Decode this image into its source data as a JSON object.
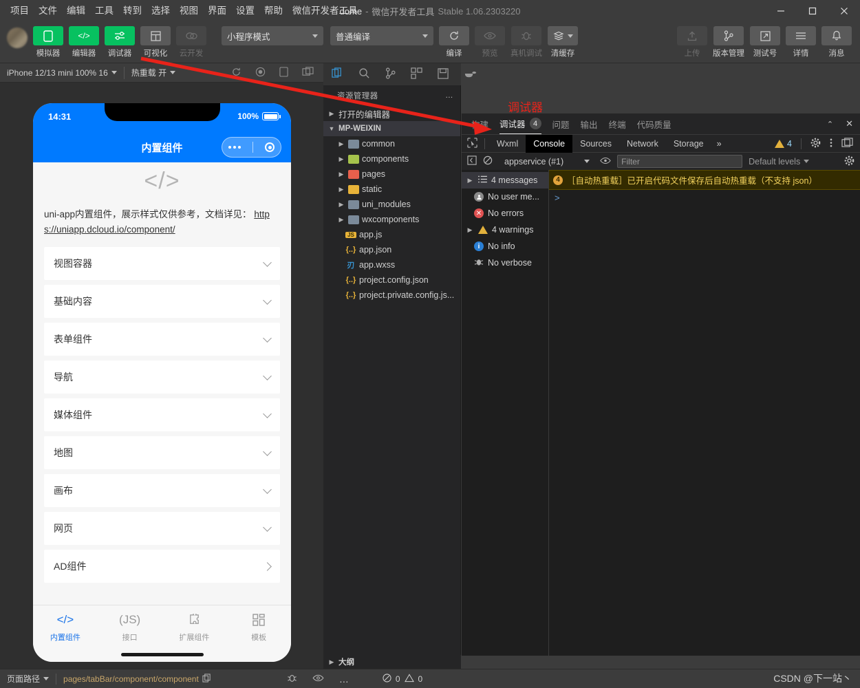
{
  "titlebar": {
    "menus": [
      "项目",
      "文件",
      "编辑",
      "工具",
      "转到",
      "选择",
      "视图",
      "界面",
      "设置",
      "帮助",
      "微信开发者工具"
    ],
    "project_name": "dome",
    "separator": "-",
    "app_name": "微信开发者工具",
    "version": "Stable 1.06.2303220",
    "window_controls": {
      "minimize": "—",
      "maximize": "▢",
      "close": "✕"
    }
  },
  "toolbar": {
    "left_items": [
      {
        "label": "模拟器",
        "icon": "phone-icon",
        "glyph": "▯",
        "state": "active"
      },
      {
        "label": "编辑器",
        "icon": "code-icon",
        "glyph": "</>",
        "state": "active"
      },
      {
        "label": "调试器",
        "icon": "sliders-icon",
        "glyph": "⇌",
        "state": "active"
      },
      {
        "label": "可视化",
        "icon": "layout-icon",
        "glyph": "▤",
        "state": "inactive"
      },
      {
        "label": "云开发",
        "icon": "cloud-icon",
        "glyph": "☁",
        "state": "disabled"
      }
    ],
    "mode_select": "小程序模式",
    "compile_select": "普通编译",
    "center_items": [
      {
        "label": "编译",
        "icon": "refresh-icon",
        "glyph": "⟳",
        "state": "active"
      },
      {
        "label": "预览",
        "icon": "eye-icon",
        "glyph": "👁",
        "state": "disabled"
      },
      {
        "label": "真机调试",
        "icon": "bug-icon",
        "glyph": "🐞",
        "state": "disabled"
      },
      {
        "label": "清缓存",
        "icon": "layers-icon",
        "glyph": "≋",
        "state": "active"
      }
    ],
    "right_items": [
      {
        "label": "上传",
        "icon": "upload-icon",
        "glyph": "↥",
        "state": "disabled"
      },
      {
        "label": "版本管理",
        "icon": "branch-icon",
        "glyph": "⑂",
        "state": "active"
      },
      {
        "label": "测试号",
        "icon": "external-link-icon",
        "glyph": "↗",
        "state": "active"
      },
      {
        "label": "详情",
        "icon": "menu-icon",
        "glyph": "≡",
        "state": "active"
      },
      {
        "label": "消息",
        "icon": "bell-icon",
        "glyph": "🔔",
        "state": "active"
      }
    ]
  },
  "simulator_bar": {
    "device": "iPhone 12/13 mini 100% 16",
    "hot_reload": "热重载 开",
    "icons": [
      "refresh-icon",
      "record-icon",
      "rotate-icon",
      "multi-window-icon"
    ]
  },
  "phone": {
    "status": {
      "time": "14:31",
      "battery_percent": "100%"
    },
    "nav_title": "内置组件",
    "capsule": {
      "dots": "•••",
      "circle": "◉"
    },
    "logo": "</>",
    "intro_text": "uni-app内置组件，展示样式仅供参考，文档详见：",
    "intro_link": "https://uniapp.dcloud.io/component/",
    "accordion": [
      {
        "label": "视图容器",
        "chevron": "down"
      },
      {
        "label": "基础内容",
        "chevron": "down"
      },
      {
        "label": "表单组件",
        "chevron": "down"
      },
      {
        "label": "导航",
        "chevron": "down"
      },
      {
        "label": "媒体组件",
        "chevron": "down"
      },
      {
        "label": "地图",
        "chevron": "down"
      },
      {
        "label": "画布",
        "chevron": "down"
      },
      {
        "label": "网页",
        "chevron": "down"
      },
      {
        "label": "AD组件",
        "chevron": "right"
      }
    ],
    "tabbar": [
      {
        "label": "内置组件",
        "icon": "code-icon",
        "glyph": "</>",
        "active": true
      },
      {
        "label": "接口",
        "icon": "js-icon",
        "glyph": "(JS)",
        "active": false
      },
      {
        "label": "扩展组件",
        "icon": "puzzle-icon",
        "glyph": "✧",
        "active": false
      },
      {
        "label": "模板",
        "icon": "grid-icon",
        "glyph": "▤",
        "active": false
      }
    ]
  },
  "explorer": {
    "activity_icons": [
      "files-icon",
      "search-icon",
      "source-control-icon",
      "extensions-icon",
      "save-icon",
      "docker-icon"
    ],
    "title": "资源管理器",
    "more": "…",
    "sections": [
      {
        "label": "打开的编辑器",
        "expanded": false
      },
      {
        "label": "MP-WEIXIN",
        "expanded": true,
        "selected": true
      }
    ],
    "tree": [
      {
        "name": "common",
        "type": "folder",
        "color": "blue"
      },
      {
        "name": "components",
        "type": "folder",
        "color": "green"
      },
      {
        "name": "pages",
        "type": "folder",
        "color": "red"
      },
      {
        "name": "static",
        "type": "folder",
        "color": "yellow"
      },
      {
        "name": "uni_modules",
        "type": "folder",
        "color": "blue"
      },
      {
        "name": "wxcomponents",
        "type": "folder",
        "color": "blue"
      },
      {
        "name": "app.js",
        "type": "file",
        "badge": "JS",
        "color": "#e8b339"
      },
      {
        "name": "app.json",
        "type": "file",
        "badge": "{..}",
        "color": "#e8b339"
      },
      {
        "name": "app.wxss",
        "type": "file",
        "badge": "刃",
        "color": "#3794d2"
      },
      {
        "name": "project.config.json",
        "type": "file",
        "badge": "{..}",
        "color": "#e8b339"
      },
      {
        "name": "project.private.config.js...",
        "type": "file",
        "badge": "{..}",
        "color": "#e8b339"
      }
    ],
    "outline": "大纲"
  },
  "debugger": {
    "annotation_label": "调试器",
    "panel_tabs": [
      {
        "label": "构建",
        "active": false
      },
      {
        "label": "调试器",
        "active": true,
        "badge": "4"
      },
      {
        "label": "问题",
        "active": false
      },
      {
        "label": "输出",
        "active": false
      },
      {
        "label": "终端",
        "active": false
      },
      {
        "label": "代码质量",
        "active": false
      }
    ],
    "panel_controls": {
      "collapse": "⌃",
      "close": "✕"
    },
    "devtool_tabs": [
      {
        "label": "Wxml",
        "active": false
      },
      {
        "label": "Console",
        "active": true
      },
      {
        "label": "Sources",
        "active": false
      },
      {
        "label": "Network",
        "active": false
      },
      {
        "label": "Storage",
        "active": false
      }
    ],
    "devtool_more": "»",
    "inspect_icon": "cursor-select-icon",
    "warning_count": "4",
    "devtool_right_icons": [
      "gear-icon",
      "kebab-menu-icon",
      "dock-icon"
    ],
    "console_toolbar": {
      "sidebar_toggle_icon": "sidebar-toggle-icon",
      "clear_icon": "clear-console-icon",
      "context": "appservice (#1)",
      "eye_icon": "eye-icon",
      "filter_placeholder": "Filter",
      "levels": "Default levels",
      "settings_icon": "gear-icon"
    },
    "console_sidebar": [
      {
        "label": "4 messages",
        "icon": "list-icon",
        "selected": true,
        "expandable": true
      },
      {
        "label": "No user me...",
        "icon": "user-icon",
        "selected": false,
        "expandable": false
      },
      {
        "label": "No errors",
        "icon": "error-icon",
        "selected": false,
        "expandable": false
      },
      {
        "label": "4 warnings",
        "icon": "warning-icon",
        "selected": false,
        "expandable": true
      },
      {
        "label": "No info",
        "icon": "info-icon",
        "selected": false,
        "expandable": false
      },
      {
        "label": "No verbose",
        "icon": "verbose-icon",
        "selected": false,
        "expandable": false
      }
    ],
    "messages": [
      {
        "count": "4",
        "level": "warning",
        "text": "［自动热重载］已开启代码文件保存后自动热重载（不支持 json）"
      }
    ],
    "prompt_symbol": ">"
  },
  "statusbar": {
    "page_path_label": "页面路径",
    "page_path_value": "pages/tabBar/component/component",
    "copy_icon": "copy-icon",
    "icons": [
      "bug-icon",
      "eye-icon",
      "more-icon"
    ],
    "errors": "0",
    "warnings": "0",
    "watermark": "CSDN @下一站丶"
  },
  "colors": {
    "accent_green": "#07c160",
    "phone_blue": "#007aff",
    "annotation_red": "#e8231a",
    "warning_yellow": "#e2b13c",
    "link_blue": "#3794d2"
  }
}
